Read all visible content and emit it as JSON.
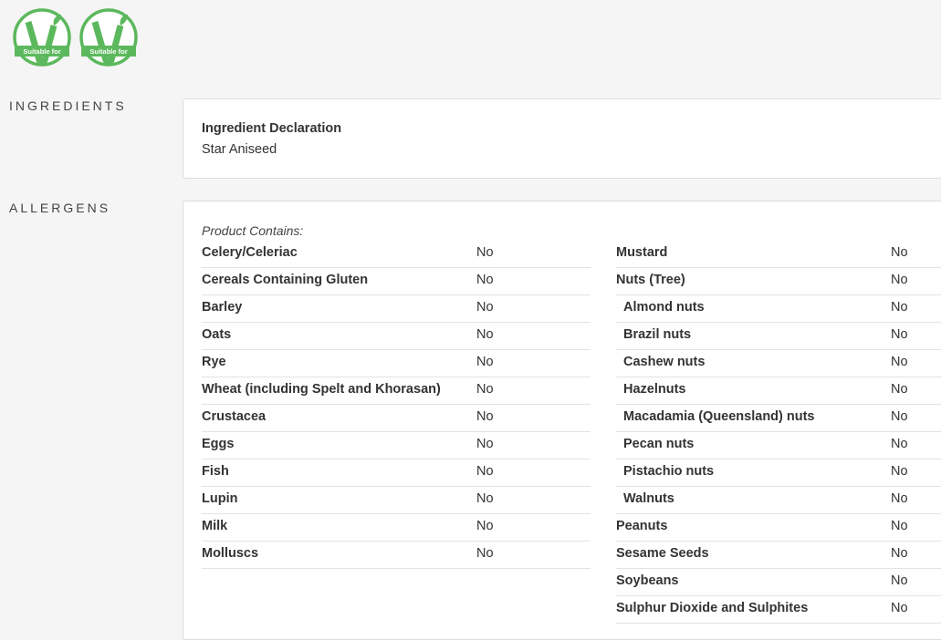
{
  "badges": [
    {
      "label": "Suitable for",
      "icon": "vegetarian-v-icon",
      "color": "#5cb85c"
    },
    {
      "label": "Suitable for",
      "icon": "vegan-v-icon",
      "color": "#5cb85c"
    }
  ],
  "ingredients": {
    "section_label": "INGREDIENTS",
    "title": "Ingredient Declaration",
    "text": "Star Aniseed"
  },
  "allergens": {
    "section_label": "ALLERGENS",
    "contains_label": "Product Contains:",
    "left": [
      {
        "name": "Celery/Celeriac",
        "value": "No"
      },
      {
        "name": "Cereals Containing Gluten",
        "value": "No"
      },
      {
        "name": "Barley",
        "value": "No"
      },
      {
        "name": "Oats",
        "value": "No"
      },
      {
        "name": "Rye",
        "value": "No"
      },
      {
        "name": "Wheat (including Spelt and Khorasan)",
        "value": "No"
      },
      {
        "name": "Crustacea",
        "value": "No"
      },
      {
        "name": "Eggs",
        "value": "No"
      },
      {
        "name": "Fish",
        "value": "No"
      },
      {
        "name": "Lupin",
        "value": "No"
      },
      {
        "name": "Milk",
        "value": "No"
      },
      {
        "name": "Molluscs",
        "value": "No"
      }
    ],
    "right": [
      {
        "name": "Mustard",
        "value": "No"
      },
      {
        "name": "Nuts (Tree)",
        "value": "No"
      },
      {
        "name": "Almond nuts",
        "value": "No"
      },
      {
        "name": "Brazil nuts",
        "value": "No"
      },
      {
        "name": "Cashew nuts",
        "value": "No"
      },
      {
        "name": "Hazelnuts",
        "value": "No"
      },
      {
        "name": "Macadamia (Queensland) nuts",
        "value": "No"
      },
      {
        "name": "Pecan nuts",
        "value": "No"
      },
      {
        "name": "Pistachio nuts",
        "value": "No"
      },
      {
        "name": "Walnuts",
        "value": "No"
      },
      {
        "name": "Peanuts",
        "value": "No"
      },
      {
        "name": "Sesame Seeds",
        "value": "No"
      },
      {
        "name": "Soybeans",
        "value": "No"
      },
      {
        "name": "Sulphur Dioxide and Sulphites",
        "value": "No"
      }
    ]
  }
}
